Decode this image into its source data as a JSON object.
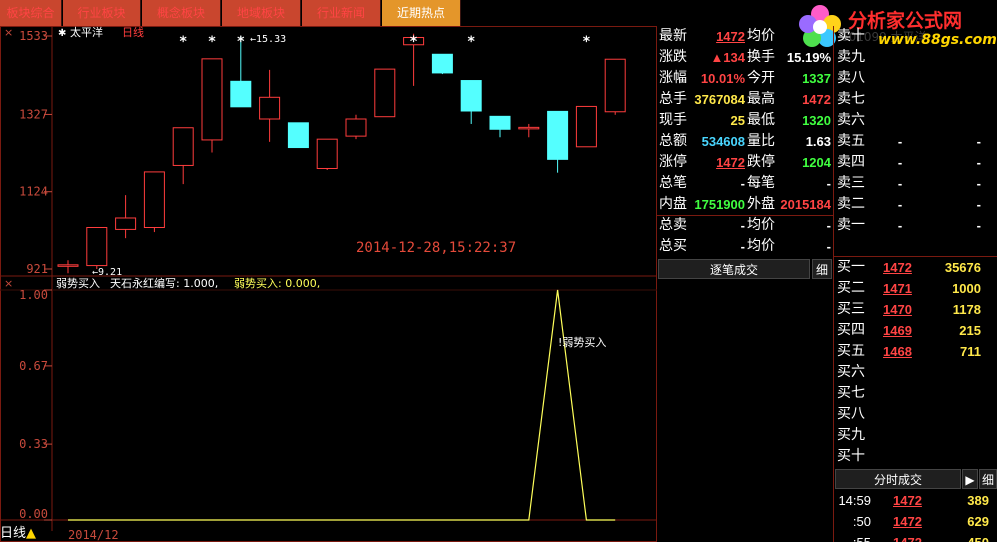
{
  "tabs": [
    {
      "label": "板块综合",
      "style": "red"
    },
    {
      "label": "行业板块",
      "style": "red"
    },
    {
      "label": "概念板块",
      "style": "red"
    },
    {
      "label": "地域板块",
      "style": "red"
    },
    {
      "label": "行业新闻",
      "style": "orange"
    },
    {
      "label": "近期热点",
      "style": "orange"
    }
  ],
  "logo": {
    "title": "分析家公式网",
    "url": "www.88gs.com",
    "bg_text": "601099 太平洋"
  },
  "chart": {
    "stock_name": "太平洋",
    "period": "日线",
    "datetime": "2014-12-28,15:22:37",
    "high_marker": "←15.33",
    "low_marker": "←9.21",
    "star": "*",
    "month_label": "2014/12",
    "status_label": "日线"
  },
  "chart_data": [
    {
      "type": "candlestick",
      "title": "太平洋 日线",
      "y_ticks": [
        "1533",
        "1327",
        "1124",
        "921"
      ],
      "ylim": [
        9.21,
        15.33
      ],
      "candles": [
        {
          "open": 9.32,
          "close": 9.32,
          "high": 9.44,
          "low": 9.1
        },
        {
          "open": 9.3,
          "close": 10.3,
          "high": 10.3,
          "low": 9.21
        },
        {
          "open": 10.25,
          "close": 10.55,
          "high": 11.15,
          "low": 10.02
        },
        {
          "open": 10.3,
          "close": 11.76,
          "high": 11.76,
          "low": 10.18
        },
        {
          "open": 11.93,
          "close": 12.92,
          "high": 12.92,
          "low": 11.44
        },
        {
          "open": 12.6,
          "close": 14.73,
          "high": 14.73,
          "low": 12.27
        },
        {
          "open": 14.14,
          "close": 13.47,
          "high": 15.33,
          "low": 13.47
        },
        {
          "open": 13.15,
          "close": 13.72,
          "high": 14.44,
          "low": 12.55
        },
        {
          "open": 13.05,
          "close": 12.4,
          "high": 13.05,
          "low": 12.4
        },
        {
          "open": 11.85,
          "close": 12.62,
          "high": 12.62,
          "low": 11.81
        },
        {
          "open": 12.7,
          "close": 13.15,
          "high": 13.26,
          "low": 12.62
        },
        {
          "open": 13.21,
          "close": 14.46,
          "high": 14.46,
          "low": 13.21
        },
        {
          "open": 15.1,
          "close": 15.29,
          "high": 15.39,
          "low": 14.02
        },
        {
          "open": 14.85,
          "close": 14.36,
          "high": 14.85,
          "low": 14.33
        },
        {
          "open": 14.16,
          "close": 13.36,
          "high": 14.16,
          "low": 13.02
        },
        {
          "open": 13.22,
          "close": 12.88,
          "high": 13.22,
          "low": 12.67
        },
        {
          "open": 12.93,
          "close": 12.93,
          "high": 13.02,
          "low": 12.67
        },
        {
          "open": 13.35,
          "close": 12.09,
          "high": 13.35,
          "low": 11.74
        },
        {
          "open": 12.42,
          "close": 13.48,
          "high": 13.48,
          "low": 12.42
        },
        {
          "open": 13.34,
          "close": 14.72,
          "high": 14.72,
          "low": 13.26
        }
      ],
      "star_candles": [
        4,
        5,
        6,
        12,
        14,
        18
      ]
    },
    {
      "type": "line",
      "title": "弱势买入",
      "legend": [
        "弱势买入",
        "天石永红编写: 1.000,",
        "弱势买入: 0.000,"
      ],
      "y_ticks": [
        "1.00",
        "0.67",
        "0.33",
        "0.00"
      ],
      "ylim": [
        0,
        1
      ],
      "values": [
        0,
        0,
        0,
        0,
        0,
        0,
        0,
        0,
        0,
        0,
        0,
        0,
        0,
        0,
        0,
        0,
        0,
        1,
        0,
        0
      ],
      "annotation": "!弱势买入"
    }
  ],
  "quote": {
    "rows": [
      {
        "l1": "最新",
        "v1": "1472",
        "c1": "red",
        "u1": true,
        "l2": "均价",
        "v2": "",
        "c2": "white"
      },
      {
        "l1": "涨跌",
        "v1": "▲134",
        "c1": "red",
        "u1": false,
        "l2": "换手",
        "v2": "15.19%",
        "c2": "white"
      },
      {
        "l1": "涨幅",
        "v1": "10.01%",
        "c1": "red",
        "u1": false,
        "l2": "今开",
        "v2": "1337",
        "c2": "green"
      },
      {
        "l1": "总手",
        "v1": "3767084",
        "c1": "yellow",
        "u1": false,
        "l2": "最高",
        "v2": "1472",
        "c2": "red"
      },
      {
        "l1": "现手",
        "v1": "25",
        "c1": "yellow",
        "u1": false,
        "l2": "最低",
        "v2": "1320",
        "c2": "green"
      },
      {
        "l1": "总额",
        "v1": "534608",
        "c1": "cyan",
        "u1": false,
        "l2": "量比",
        "v2": "1.63",
        "c2": "white"
      },
      {
        "l1": "涨停",
        "v1": "1472",
        "c1": "red",
        "u1": true,
        "l2": "跌停",
        "v2": "1204",
        "c2": "green"
      },
      {
        "l1": "总笔",
        "v1": "-",
        "c1": "white",
        "u1": false,
        "l2": "每笔",
        "v2": "-",
        "c2": "white"
      },
      {
        "l1": "内盘",
        "v1": "1751900",
        "c1": "green",
        "u1": false,
        "l2": "外盘",
        "v2": "2015184",
        "c2": "red"
      },
      {
        "l1": "总卖",
        "v1": "-",
        "c1": "white",
        "u1": false,
        "l2": "均价",
        "v2": "-",
        "c2": "white"
      },
      {
        "l1": "总买",
        "v1": "-",
        "c1": "white",
        "u1": false,
        "l2": "均价",
        "v2": "-",
        "c2": "white"
      }
    ],
    "tick_button": "逐笔成交",
    "tick_small": "细"
  },
  "book": {
    "sell": [
      {
        "label": "卖十",
        "price": "",
        "vol": ""
      },
      {
        "label": "卖九",
        "price": "",
        "vol": ""
      },
      {
        "label": "卖八",
        "price": "",
        "vol": ""
      },
      {
        "label": "卖七",
        "price": "",
        "vol": ""
      },
      {
        "label": "卖六",
        "price": "",
        "vol": ""
      },
      {
        "label": "卖五",
        "price": "-",
        "vol": "-"
      },
      {
        "label": "卖四",
        "price": "-",
        "vol": "-"
      },
      {
        "label": "卖三",
        "price": "-",
        "vol": "-"
      },
      {
        "label": "卖二",
        "price": "-",
        "vol": "-"
      },
      {
        "label": "卖一",
        "price": "-",
        "vol": "-"
      }
    ],
    "buy": [
      {
        "label": "买一",
        "price": "1472",
        "vol": "35676"
      },
      {
        "label": "买二",
        "price": "1471",
        "vol": "1000"
      },
      {
        "label": "买三",
        "price": "1470",
        "vol": "1178"
      },
      {
        "label": "买四",
        "price": "1469",
        "vol": "215"
      },
      {
        "label": "买五",
        "price": "1468",
        "vol": "711"
      },
      {
        "label": "买六",
        "price": "",
        "vol": ""
      },
      {
        "label": "买七",
        "price": "",
        "vol": ""
      },
      {
        "label": "买八",
        "price": "",
        "vol": ""
      },
      {
        "label": "买九",
        "price": "",
        "vol": ""
      },
      {
        "label": "买十",
        "price": "",
        "vol": ""
      }
    ],
    "fenshi_button": "分时成交",
    "fenshi_arrow": "▶",
    "fenshi_small": "细"
  },
  "ticks": [
    {
      "time": "14:59",
      "price": "1472",
      "vol": "389"
    },
    {
      "time": ":50",
      "price": "1472",
      "vol": "629"
    },
    {
      "time": ":55",
      "price": "1472",
      "vol": "450"
    }
  ],
  "colors": {
    "up": "#ff3d3d",
    "down": "#54ffff",
    "grid": "#7a1a10",
    "line": "#ffff5a"
  }
}
